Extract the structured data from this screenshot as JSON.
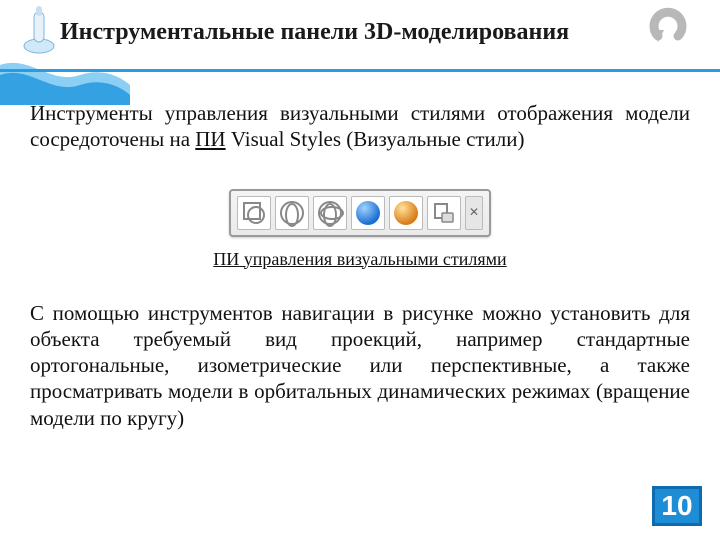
{
  "header": {
    "title": "Инструментальные панели 3D-моделирования"
  },
  "para1": {
    "pre": "Инструменты управления визуальными стилями отображения модели сосредоточены на ",
    "pi": "ПИ",
    "post": " Visual Styles (Визуальные стили)"
  },
  "toolbar": {
    "icons": [
      "wireframe-2d-icon",
      "wireframe-3d-icon",
      "hidden-icon",
      "realistic-blue-icon",
      "realistic-orange-icon",
      "manage-icon"
    ],
    "close_glyph": "✕"
  },
  "caption": {
    "pi": "ПИ",
    "rest": " управления визуальными стилями"
  },
  "para2": "С помощью инструментов навигации в рисунке можно установить для объекта требуемый вид проекций, например стандартные ортогональные, изометрические или перспективные, а также просматривать модели в орбитальных динамических режимах (вращение модели по кругу)",
  "page_number": "10"
}
